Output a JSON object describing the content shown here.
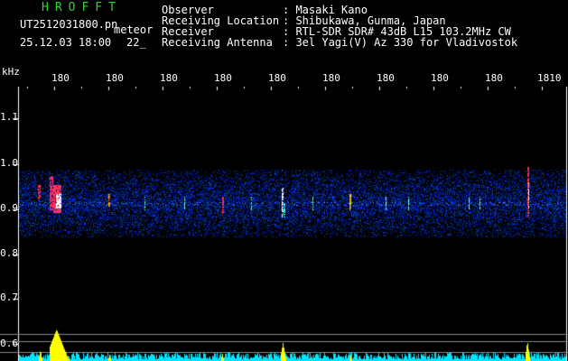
{
  "header": {
    "title": "HROFFT",
    "filename": "UT2512031800.pn",
    "meteor_label": "meteor",
    "date_time": "25.12.03 18:00",
    "count": "22_",
    "fields": [
      {
        "label": "Observer",
        "value": ": Masaki Kano"
      },
      {
        "label": "Receiving Location",
        "value": ": Shibukawa, Gunma, Japan"
      },
      {
        "label": "Receiver",
        "value": ": RTL-SDR SDR# 43dB L15 103.2MHz CW"
      },
      {
        "label": "Receiving Antenna",
        "value": ": 3el Yagi(V) Az 330 for Vladivostok"
      }
    ]
  },
  "axis": {
    "unit": "kHz",
    "y_ticks": [
      "1.1",
      "1.0",
      "0.9",
      "0.8",
      "0.7",
      "0.6"
    ],
    "x_ticks": [
      "180",
      "180",
      "180",
      "180",
      "180",
      "180",
      "180",
      "180",
      "180",
      "1810"
    ]
  },
  "colors": {
    "header_green": "#29d829",
    "noise_blue": "#1a3cff",
    "echo_red": "#ff3030",
    "signal_yellow": "#ffff00",
    "baseline_cyan": "#00e5ff"
  }
}
